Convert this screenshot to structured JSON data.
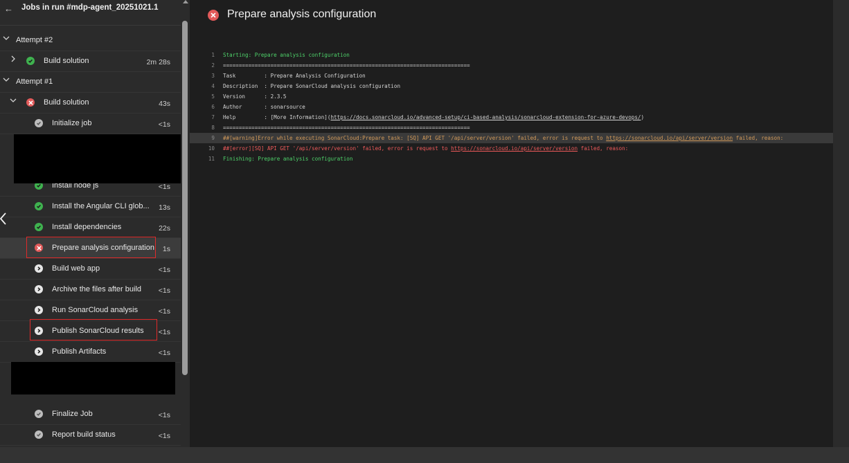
{
  "panel": {
    "back_icon": "arrow-left-icon",
    "title": "Jobs in run #mdp-agent_20251021.1"
  },
  "jobs": [
    {
      "kind": "group",
      "label": "Attempt #2",
      "expanded": true
    },
    {
      "kind": "job",
      "label": "Build solution",
      "duration": "2m 28s",
      "status": "succeeded",
      "expanded": false
    },
    {
      "kind": "group",
      "label": "Attempt #1",
      "expanded": true
    },
    {
      "kind": "job",
      "label": "Build solution",
      "duration": "43s",
      "status": "failed",
      "expanded": true
    },
    {
      "kind": "step",
      "label": "Initialize job",
      "duration": "<1s",
      "status": "skipped"
    },
    {
      "kind": "step",
      "label": "Install node js",
      "duration": "<1s",
      "status": "succeeded"
    },
    {
      "kind": "step",
      "label": "Install the Angular CLI glob...",
      "duration": "13s",
      "status": "succeeded"
    },
    {
      "kind": "step",
      "label": "Install dependencies",
      "duration": "22s",
      "status": "succeeded"
    },
    {
      "kind": "step",
      "label": "Prepare analysis configuration",
      "duration": "1s",
      "status": "failed",
      "selected": true
    },
    {
      "kind": "step",
      "label": "Build web app",
      "duration": "<1s",
      "status": "pending"
    },
    {
      "kind": "step",
      "label": "Archive the files after build",
      "duration": "<1s",
      "status": "pending"
    },
    {
      "kind": "step",
      "label": "Run SonarCloud analysis",
      "duration": "<1s",
      "status": "pending"
    },
    {
      "kind": "step",
      "label": "Publish SonarCloud results",
      "duration": "<1s",
      "status": "pending"
    },
    {
      "kind": "step",
      "label": "Publish Artifacts",
      "duration": "<1s",
      "status": "pending"
    },
    {
      "kind": "step",
      "label": "Finalize Job",
      "duration": "<1s",
      "status": "skipped"
    },
    {
      "kind": "step",
      "label": "Report build status",
      "duration": "<1s",
      "status": "skipped"
    }
  ],
  "main": {
    "title": "Prepare analysis configuration",
    "status": "failed",
    "log": [
      {
        "n": "1",
        "style": "green",
        "parts": [
          {
            "t": "Starting: Prepare analysis configuration"
          }
        ]
      },
      {
        "n": "2",
        "style": "normal",
        "parts": [
          {
            "t": "=============================================================================="
          }
        ]
      },
      {
        "n": "3",
        "style": "normal",
        "parts": [
          {
            "t": "Task         : Prepare Analysis Configuration"
          }
        ]
      },
      {
        "n": "4",
        "style": "normal",
        "parts": [
          {
            "t": "Description  : Prepare SonarCloud analysis configuration"
          }
        ]
      },
      {
        "n": "5",
        "style": "normal",
        "parts": [
          {
            "t": "Version      : 2.3.5"
          }
        ]
      },
      {
        "n": "6",
        "style": "normal",
        "parts": [
          {
            "t": "Author       : sonarsource"
          }
        ]
      },
      {
        "n": "7",
        "style": "normal",
        "parts": [
          {
            "t": "Help         : [More Information]("
          },
          {
            "t": "https://docs.sonarcloud.io/advanced-setup/ci-based-analysis/sonarcloud-extension-for-azure-devops/",
            "link": true
          },
          {
            "t": ")"
          }
        ]
      },
      {
        "n": "8",
        "style": "normal",
        "parts": [
          {
            "t": "=============================================================================="
          }
        ]
      },
      {
        "n": "9",
        "style": "warn",
        "highlight": true,
        "parts": [
          {
            "t": "##[warning]Error while executing SonarCloud:Prepare task: [SQ] API GET '/api/server/version' failed, error is request to "
          },
          {
            "t": "https://sonarcloud.io/api/server/version",
            "link": true
          },
          {
            "t": " failed, reason:"
          }
        ]
      },
      {
        "n": "10",
        "style": "error",
        "parts": [
          {
            "t": "##[error][SQ] API GET '/api/server/version' failed, error is request to "
          },
          {
            "t": "https://sonarcloud.io/api/server/version",
            "link": true
          },
          {
            "t": " failed, reason:"
          }
        ]
      },
      {
        "n": "11",
        "style": "green",
        "parts": [
          {
            "t": "Finishing: Prepare analysis configuration"
          }
        ]
      }
    ]
  },
  "colors": {
    "succeeded": "#3fb24f",
    "failed": "#e25a5a",
    "skipped": "#bdbdbd",
    "pending": "#e6e6e6",
    "highlight_border": "#e02a2a"
  }
}
